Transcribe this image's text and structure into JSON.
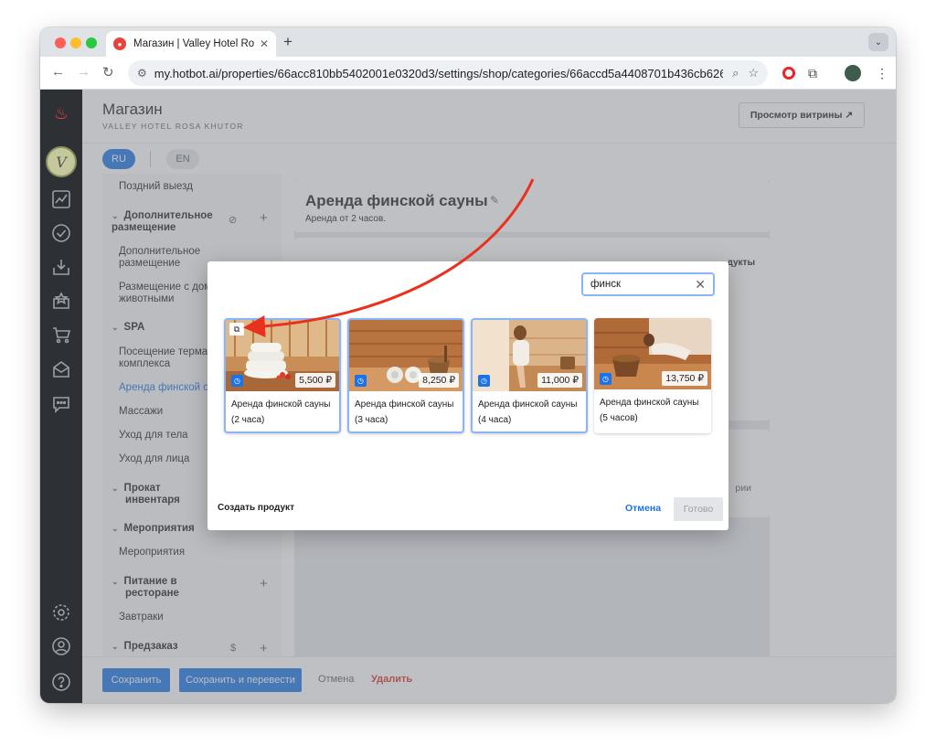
{
  "browser": {
    "tab_title": "Магазин | Valley Hotel Rosa K",
    "url": "my.hotbot.ai/properties/66acc810bb5402001e0320d3/settings/shop/categories/66accd5a4408701b436cb626"
  },
  "header": {
    "title": "Магазин",
    "subtitle": "VALLEY HOTEL ROSA KHUTOR",
    "preview_button": "Просмотр витрины ↗"
  },
  "languages": {
    "ru": "RU",
    "en": "EN"
  },
  "categories": {
    "late_checkout": "Поздний выезд",
    "group_extra": "Дополнительное размещение",
    "extra_item_1": "Дополнительное",
    "extra_item_2": "размещение",
    "pets_1": "Размещение с дом",
    "pets_2": "животными",
    "group_spa": "SPA",
    "thermal_1": "Посещение терма",
    "thermal_2": "комплекса",
    "sauna": "Аренда финской с",
    "massage": "Массажи",
    "body": "Уход для тела",
    "face": "Уход для лица",
    "group_rental_1": "Прокат",
    "group_rental_2": "инвентаря",
    "group_events": "Мероприятия",
    "events": "Мероприятия",
    "group_food_1": "Питание в",
    "group_food_2": "ресторане",
    "breakfast": "Завтраки",
    "group_preorder": "Предзаказ"
  },
  "product": {
    "title": "Аренда финской сауны",
    "subtitle": "Аренда от 2 часов.",
    "products_label": "дукты",
    "category_label": "рии"
  },
  "footer": {
    "save": "Сохранить",
    "save_translate": "Сохранить и перевести",
    "cancel": "Отмена",
    "delete": "Удалить"
  },
  "modal": {
    "search_value": "финск",
    "create_product": "Создать продукт",
    "cancel": "Отмена",
    "done": "Готово",
    "products": [
      {
        "name": "Аренда финской сауны (2 часа)",
        "name_1": "Аренда финской сауны",
        "name_2": "(2 часа)",
        "price": "5,500 ₽",
        "selected": true
      },
      {
        "name": "Аренда финской сауны (3 часа)",
        "name_1": "Аренда финской сауны",
        "name_2": "(3 часа)",
        "price": "8,250 ₽",
        "selected": true
      },
      {
        "name": "Аренда финской сауны (4 часа)",
        "name_1": "Аренда финской сауны",
        "name_2": "(4 часа)",
        "price": "11,000 ₽",
        "selected": true
      },
      {
        "name": "Аренда финской сауны (5 часов)",
        "name_1": "Аренда финской сауны",
        "name_2": "(5 часов)",
        "price": "13,750 ₽",
        "selected": false
      }
    ]
  },
  "colors": {
    "accent": "#1a73e8",
    "danger": "#d93025",
    "annotation_arrow": "#e8321f"
  }
}
